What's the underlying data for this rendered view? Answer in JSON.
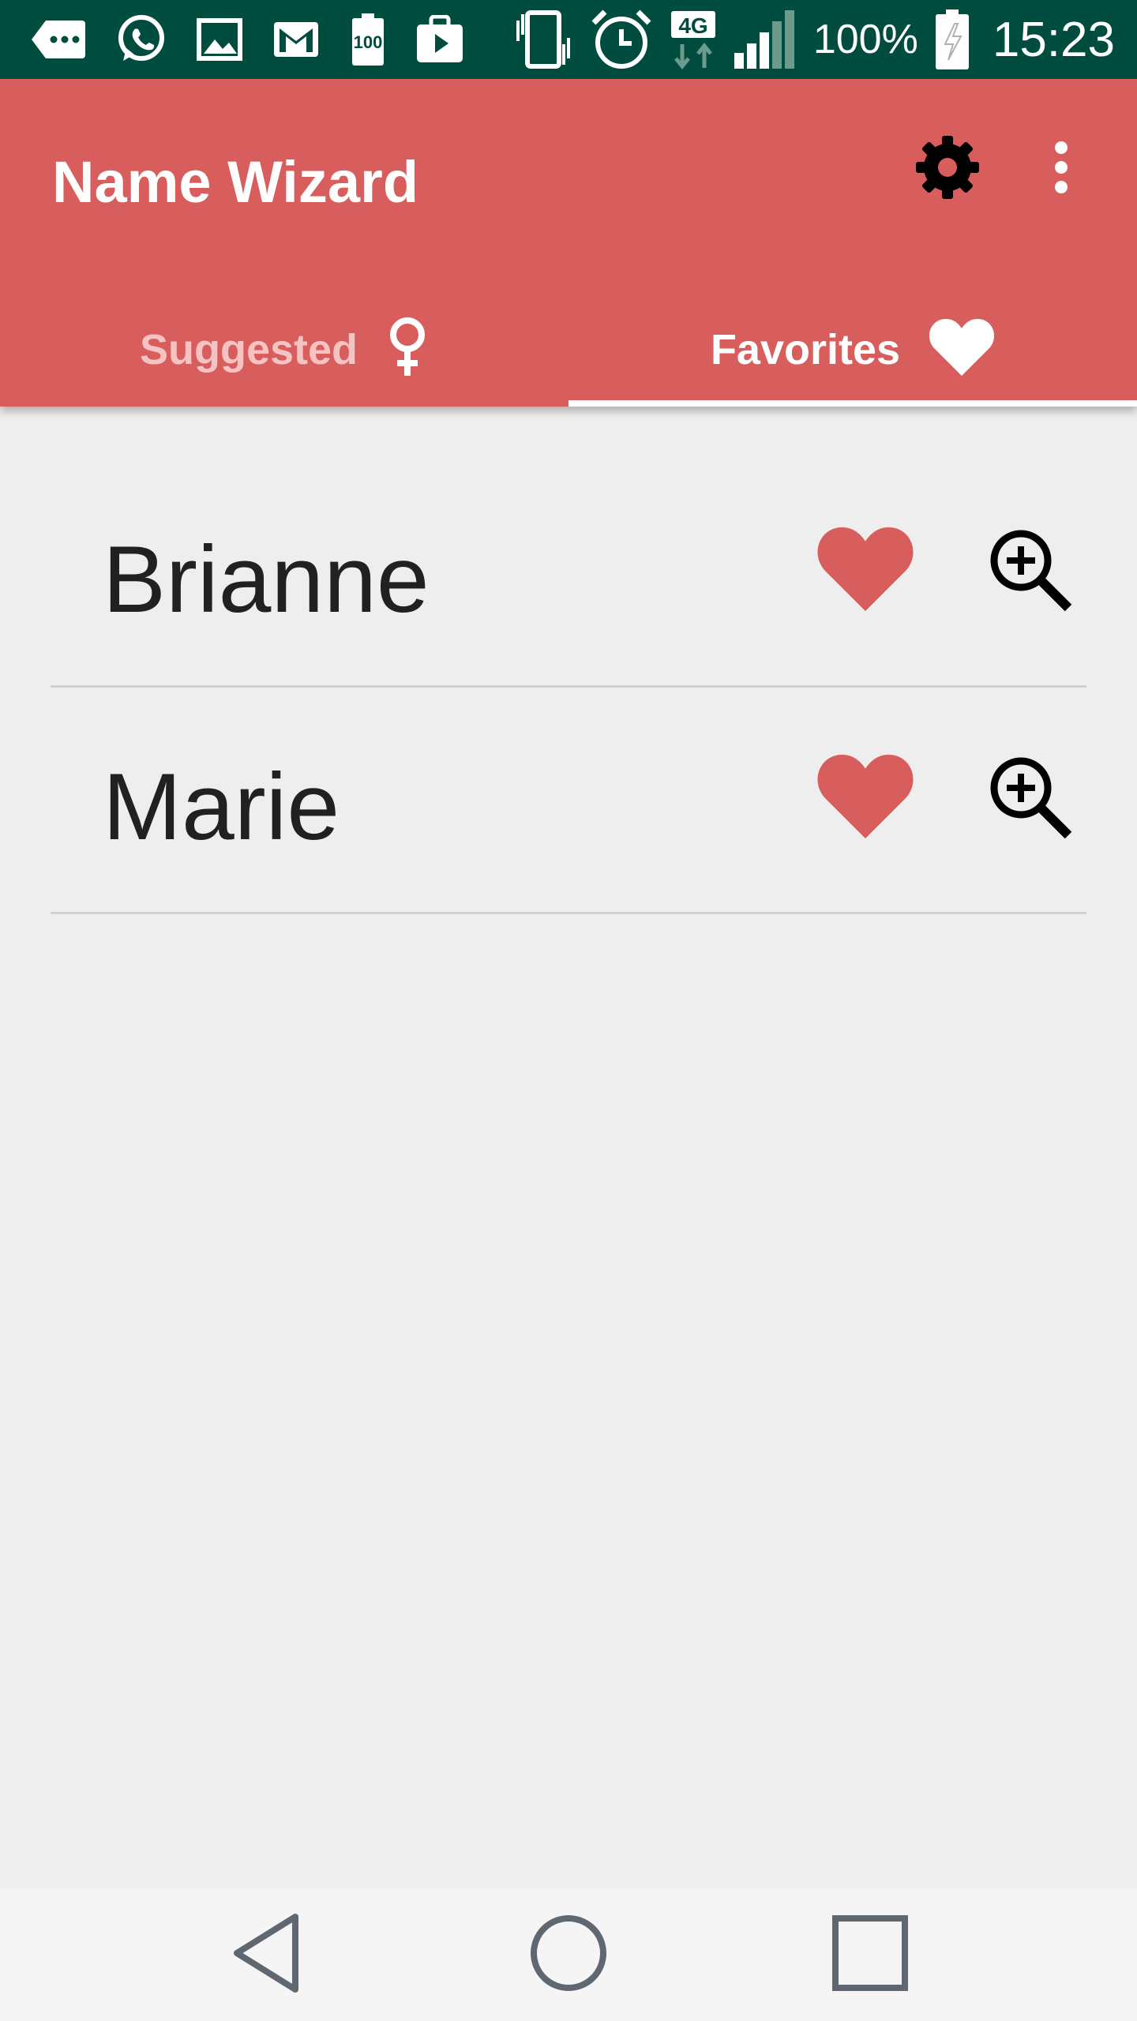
{
  "status_bar": {
    "battery_percent": "100%",
    "time": "15:23",
    "network_type": "4G",
    "battery_saver_badge": "100",
    "icons": [
      "message-icon",
      "whatsapp-icon",
      "gallery-icon",
      "gmail-icon",
      "battery-100-icon",
      "play-store-icon",
      "vibrate-icon",
      "alarm-icon",
      "network-4g-icon",
      "signal-icon",
      "battery-charging-icon"
    ]
  },
  "app_bar": {
    "title": "Name Wizard",
    "background_color": "#d85e5e",
    "actions": [
      "gear-icon",
      "more-vert-icon"
    ]
  },
  "tabs": [
    {
      "label": "Suggested",
      "icon": "female-icon",
      "selected": false
    },
    {
      "label": "Favorites",
      "icon": "heart-icon",
      "selected": true
    }
  ],
  "favorites": [
    {
      "name": "Brianne",
      "favorite_icon": "heart-icon",
      "details_icon": "zoom-in-icon"
    },
    {
      "name": "Marie",
      "favorite_icon": "heart-icon",
      "details_icon": "zoom-in-icon"
    }
  ],
  "nav_bar": {
    "buttons": [
      "back-icon",
      "home-icon",
      "recents-icon"
    ]
  },
  "colors": {
    "accent": "#d85e5e",
    "status_bar": "#004d40",
    "background": "#eeeeee"
  }
}
